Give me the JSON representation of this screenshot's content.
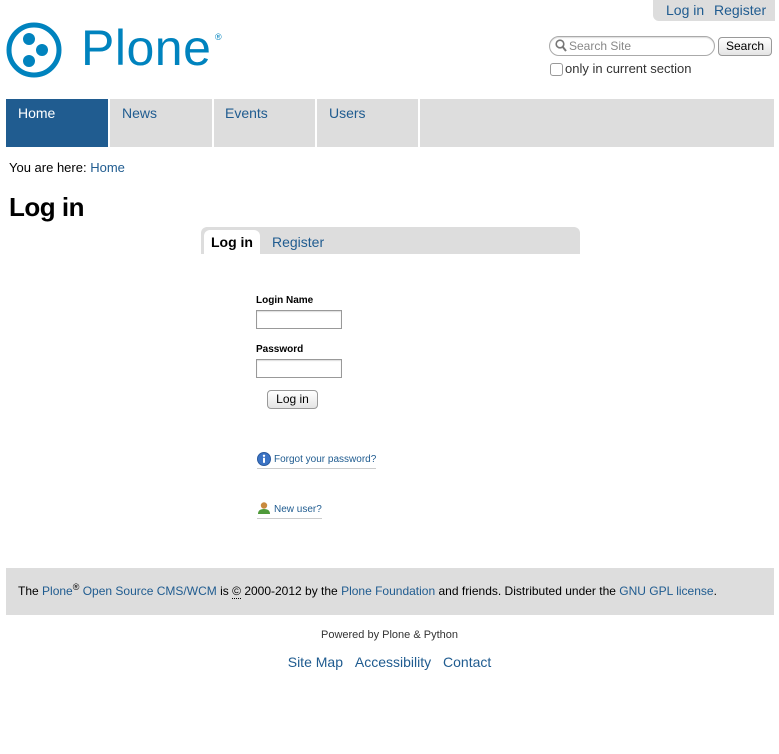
{
  "personal_bar": {
    "login": "Log in",
    "register": "Register"
  },
  "logo": {
    "text": "Plone",
    "registered": "®",
    "color": "#0083be"
  },
  "search": {
    "placeholder": "Search Site",
    "value": "",
    "button": "Search",
    "section_only_label": "only in current section",
    "section_only_checked": false
  },
  "nav": {
    "active_color": "#205c90",
    "tabs": [
      {
        "label": "Home",
        "active": true
      },
      {
        "label": "News",
        "active": false
      },
      {
        "label": "Events",
        "active": false
      },
      {
        "label": "Users",
        "active": false
      }
    ]
  },
  "breadcrumb": {
    "prefix": "You are here:",
    "items": [
      "Home"
    ]
  },
  "page": {
    "title": "Log in"
  },
  "tabs": {
    "items": [
      {
        "label": "Log in",
        "active": true
      },
      {
        "label": "Register",
        "active": false
      }
    ]
  },
  "form": {
    "login_label": "Login Name",
    "login_value": "",
    "password_label": "Password",
    "password_value": "",
    "submit": "Log in",
    "forgot": "Forgot your password?",
    "new_user": "New user?"
  },
  "footer": {
    "the": "The",
    "plone": "Plone",
    "reg": "®",
    "cms": "Open Source CMS/WCM",
    "is": "is",
    "copy": "©",
    "years": "2000-2012 by the",
    "foundation": "Plone Foundation",
    "friends": "and friends. Distributed under the",
    "license": "GNU GPL license",
    "period": ".",
    "powered": "Powered by Plone & Python",
    "actions": [
      "Site Map",
      "Accessibility",
      "Contact"
    ]
  }
}
